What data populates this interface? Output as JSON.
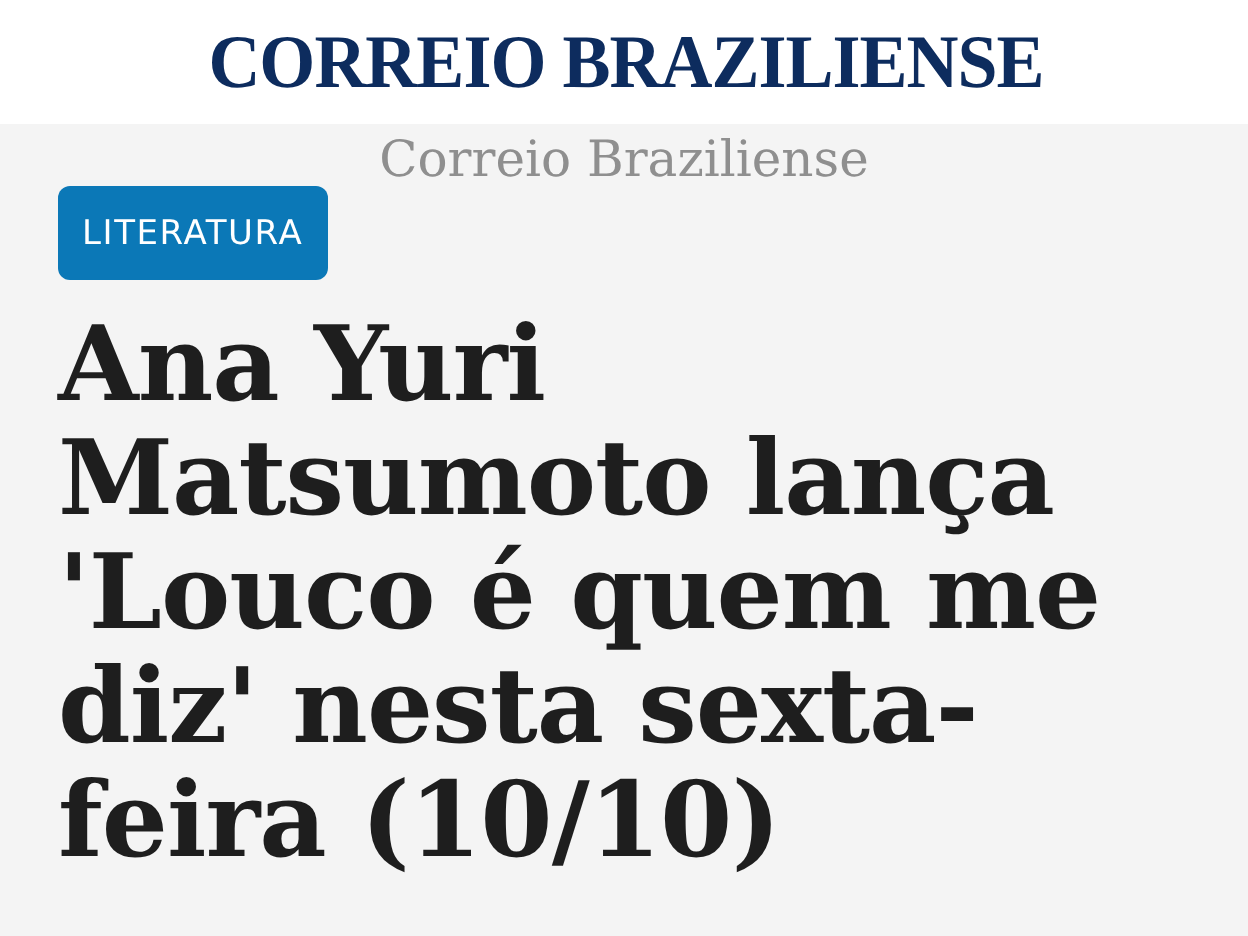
{
  "header": {
    "logo": "CORREIO BRAZILIENSE"
  },
  "logo_alt_text": "Correio Braziliense",
  "article": {
    "category": "LITERATURA",
    "headline": "Ana Yuri Matsumoto lança 'Louco é quem me diz' nesta sexta-feira (10/10)"
  }
}
